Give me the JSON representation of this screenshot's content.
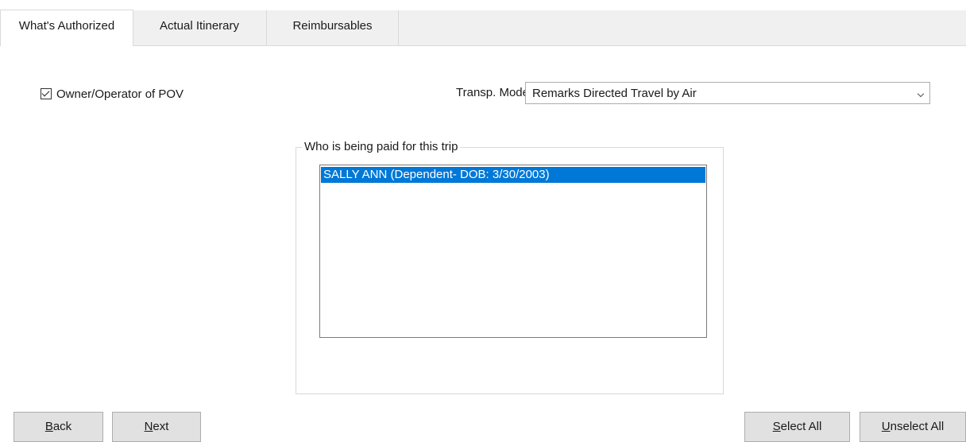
{
  "tabs": [
    {
      "label": "What's Authorized",
      "active": true
    },
    {
      "label": "Actual Itinerary",
      "active": false
    },
    {
      "label": "Reimbursables",
      "active": false
    }
  ],
  "pov": {
    "label": "Owner/Operator of POV",
    "checked": true
  },
  "transport": {
    "label": "Transp. Mode",
    "selected": "Remarks Directed Travel by Air"
  },
  "payees": {
    "group_title": "Who is being paid for this trip",
    "items": [
      {
        "label": "SALLY ANN (Dependent- DOB: 3/30/2003)",
        "selected": true
      }
    ]
  },
  "buttons": {
    "back_mnemonic": "B",
    "back_rest": "ack",
    "next_mnemonic": "N",
    "next_rest": "ext",
    "select_all_mnemonic": "S",
    "select_all_rest": "elect All",
    "unselect_all_mnemonic": "U",
    "unselect_all_rest": "nselect All"
  },
  "colors": {
    "selection": "#0078d7",
    "tab_bg": "#f0f0f0",
    "button_bg": "#e1e1e1"
  }
}
